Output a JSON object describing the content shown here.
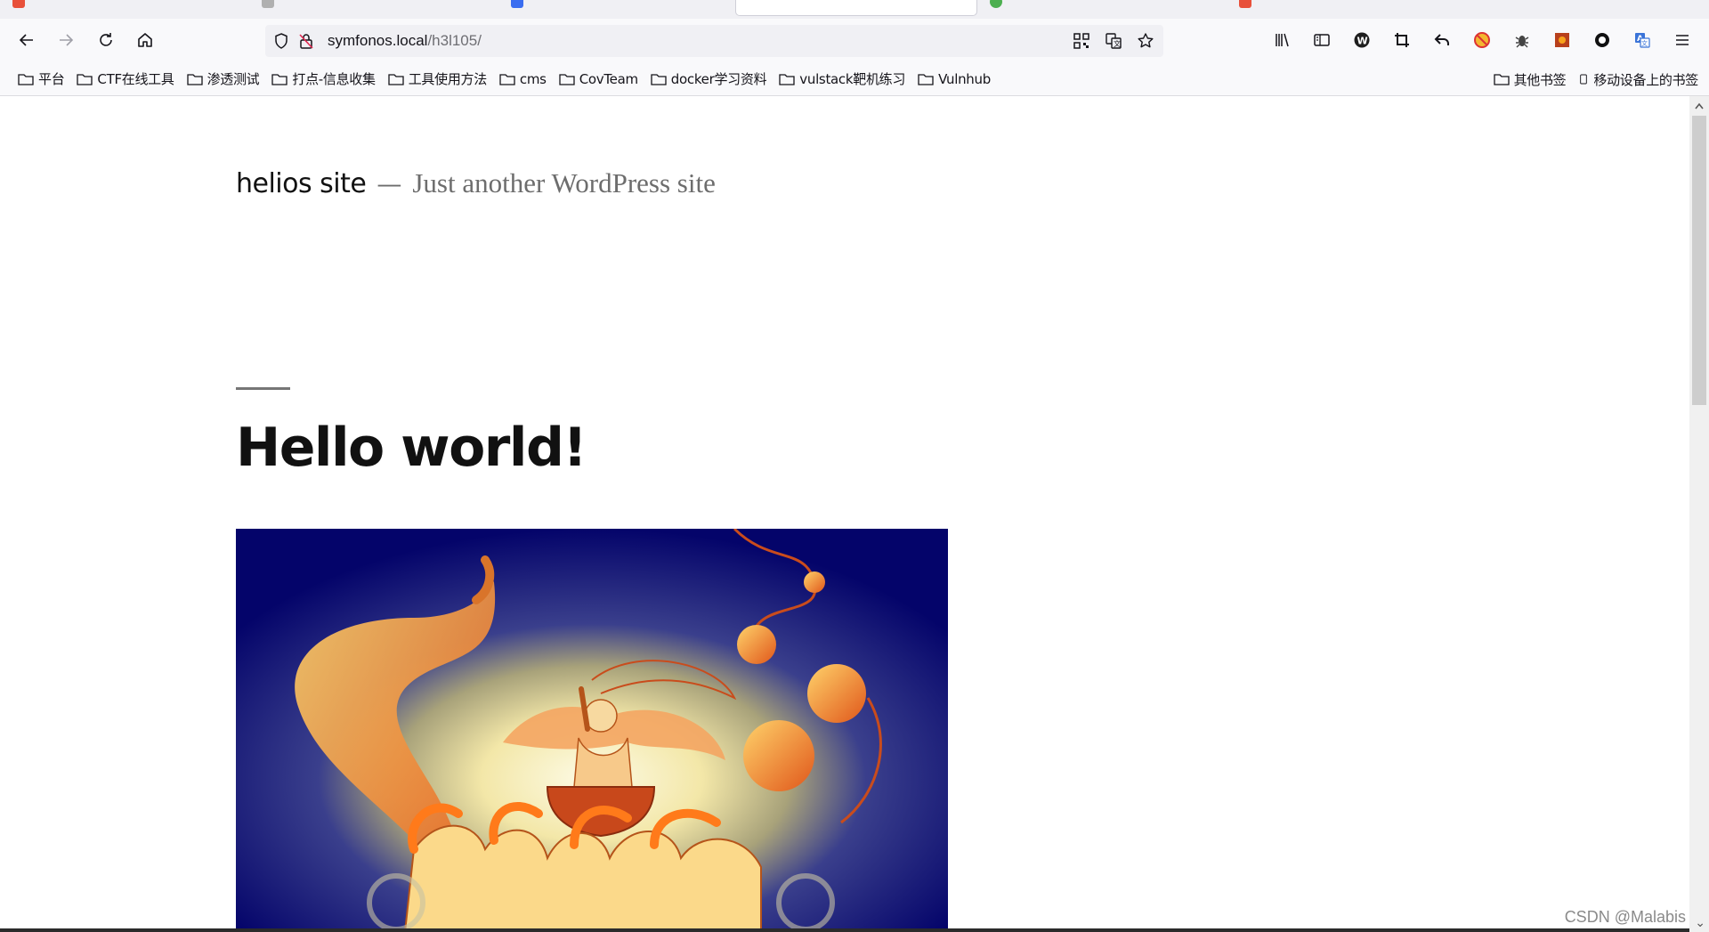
{
  "browser": {
    "tabs": [
      {
        "title": "",
        "favicon_color": "#e8503a",
        "active": false
      },
      {
        "title": "",
        "favicon_color": "#b0b0b0",
        "active": false
      },
      {
        "title": "",
        "favicon_color": "#3a6df0",
        "active": false
      },
      {
        "title": "",
        "favicon_color": "#ffffff",
        "active": true
      },
      {
        "title": "",
        "favicon_color": "#4caf50",
        "active": false
      },
      {
        "title": "",
        "favicon_color": "#e8503a",
        "active": false
      }
    ],
    "url": {
      "host": "symfonos.local",
      "path": "/h3l105/"
    },
    "toolbar_icons": [
      "library-icon",
      "sidebar-icon",
      "wordpress-icon",
      "crop-icon",
      "undo-icon",
      "block-icon",
      "bug-icon",
      "extension-icon",
      "circle-icon",
      "translate-icon",
      "menu-icon"
    ],
    "bookmarks": [
      {
        "label": "平台"
      },
      {
        "label": "CTF在线工具"
      },
      {
        "label": "渗透测试"
      },
      {
        "label": "打点-信息收集"
      },
      {
        "label": "工具使用方法"
      },
      {
        "label": "cms"
      },
      {
        "label": "CovTeam"
      },
      {
        "label": "docker学习资料"
      },
      {
        "label": "vulstack靶机练习"
      },
      {
        "label": "Vulnhub"
      }
    ],
    "other_bookmarks": "其他书签",
    "mobile_bookmarks": "移动设备上的书签"
  },
  "page": {
    "site_title": "helios site",
    "separator": "—",
    "site_description": "Just another WordPress site",
    "entry_title": "Hello world!"
  },
  "watermark": "CSDN @Malabis",
  "colors": {
    "image_background": "#04046a",
    "image_glow": "#f3e7a8",
    "image_orange": "#f0902a"
  }
}
